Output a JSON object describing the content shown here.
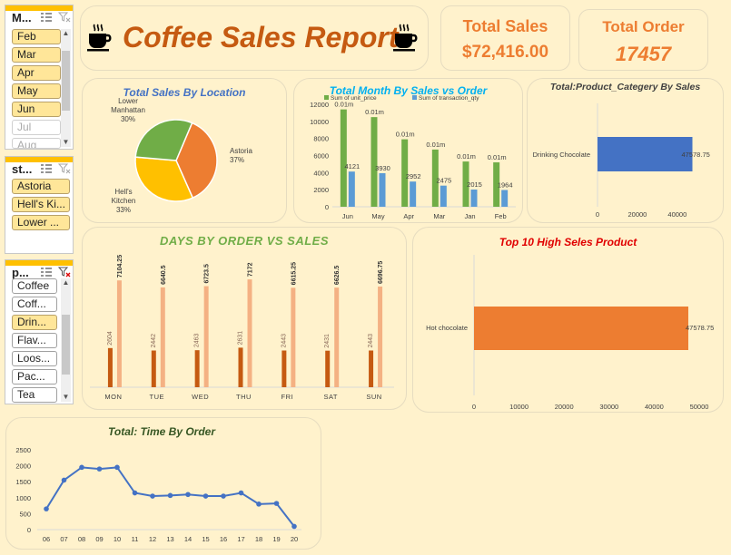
{
  "slicers": {
    "month": {
      "header": "M...",
      "items": [
        "Feb",
        "Mar",
        "Apr",
        "May",
        "Jun",
        "Jul",
        "Aug"
      ],
      "dim": [
        "Jul",
        "Aug"
      ]
    },
    "store": {
      "header": "st...",
      "items": [
        "Astoria",
        "Hell's Ki...",
        "Lower ..."
      ]
    },
    "product": {
      "header": "p...",
      "items": [
        "Coffee",
        "Coff...",
        "Drin...",
        "Flav...",
        "Loos...",
        "Pac...",
        "Tea"
      ],
      "selected": [
        "Drin..."
      ]
    }
  },
  "header": {
    "title": "Coffee Sales Report"
  },
  "kpis": {
    "total_sales": {
      "label": "Total Sales",
      "value": "$72,416.00"
    },
    "total_order": {
      "label": "Total Order",
      "value": "17457"
    }
  },
  "colors": {
    "orange": "#ed7d31",
    "green": "#70ad47",
    "yellow": "#ffc000",
    "blue": "#4472c4",
    "lightblue": "#5b9bd5",
    "salmon": "#f4b183",
    "darkorange": "#c55a11",
    "blue_title": "#4472c4",
    "green_title": "#70ad47",
    "red_title": "#e00000"
  },
  "chart_data": [
    {
      "id": "location",
      "type": "pie",
      "title": "Total Sales By Location",
      "labels": [
        "Astoria",
        "Hell's Kitchen",
        "Lower Manhattan"
      ],
      "values": [
        37,
        33,
        30
      ],
      "value_labels": [
        "37%",
        "33%",
        "30%"
      ]
    },
    {
      "id": "month",
      "type": "bar",
      "title": "Total Month By Sales vs Order",
      "categories": [
        "Jun",
        "May",
        "Apr",
        "Mar",
        "Jan",
        "Feb"
      ],
      "series": [
        {
          "name": "Sum of unit_price",
          "values": [
            11400,
            10500,
            7900,
            6700,
            5300,
            5200
          ],
          "data_labels": [
            "0.01m",
            "0.01m",
            "0.01m",
            "0.01m",
            "0.01m",
            "0.01m"
          ]
        },
        {
          "name": "Sum of transaction_qty",
          "values": [
            4121,
            3930,
            2952,
            2475,
            2015,
            1964
          ],
          "data_labels": [
            "4121",
            "3930",
            "2952",
            "2475",
            "2015",
            "1964"
          ]
        }
      ],
      "yticks": [
        "0",
        "2000",
        "4000",
        "6000",
        "8000",
        "10000",
        "12000"
      ],
      "ylim": [
        0,
        12000
      ]
    },
    {
      "id": "category",
      "type": "bar",
      "orientation": "horizontal",
      "title": "Total:Product_Categery By Sales",
      "categories": [
        "Drinking Chocolate"
      ],
      "values": [
        47578.75
      ],
      "data_labels": [
        "47578.75"
      ],
      "xticks": [
        "0",
        "20000",
        "40000"
      ],
      "xlim": [
        0,
        56000
      ]
    },
    {
      "id": "days",
      "type": "bar",
      "title": "DAYS BY ORDER VS SALES",
      "categories": [
        "MON",
        "TUE",
        "WED",
        "THU",
        "FRI",
        "SAT",
        "SUN"
      ],
      "series": [
        {
          "name": "orders",
          "values": [
            2604,
            2442,
            2463,
            2631,
            2443,
            2431,
            2443
          ],
          "data_labels": [
            "2604",
            "2442",
            "2463",
            "2631",
            "2443",
            "2431",
            "2443"
          ]
        },
        {
          "name": "sales",
          "values": [
            7104.25,
            6640.5,
            6723.5,
            7172,
            6615.25,
            6626.5,
            6696.75
          ],
          "data_labels": [
            "7104.25",
            "6640.5",
            "6723.5",
            "7172",
            "6615.25",
            "6626.5",
            "6696.75"
          ]
        }
      ],
      "ylim": [
        0,
        7600
      ]
    },
    {
      "id": "top10",
      "type": "bar",
      "orientation": "horizontal",
      "title": "Top 10 High Seles Product",
      "categories": [
        "Hot chocolate"
      ],
      "values": [
        47578.75
      ],
      "data_labels": [
        "47578.75"
      ],
      "xticks": [
        "0",
        "10000",
        "20000",
        "30000",
        "40000",
        "50000"
      ],
      "xlim": [
        0,
        50000
      ]
    },
    {
      "id": "time",
      "type": "line",
      "title": "Total: Time By Order",
      "x": [
        "06",
        "07",
        "08",
        "09",
        "10",
        "11",
        "12",
        "13",
        "14",
        "15",
        "16",
        "17",
        "18",
        "19",
        "20"
      ],
      "y": [
        650,
        1550,
        1950,
        1900,
        1950,
        1150,
        1050,
        1070,
        1100,
        1050,
        1050,
        1150,
        800,
        820,
        100
      ],
      "yticks": [
        "0",
        "500",
        "1000",
        "1500",
        "2000",
        "2500"
      ],
      "ylim": [
        0,
        2500
      ]
    }
  ]
}
